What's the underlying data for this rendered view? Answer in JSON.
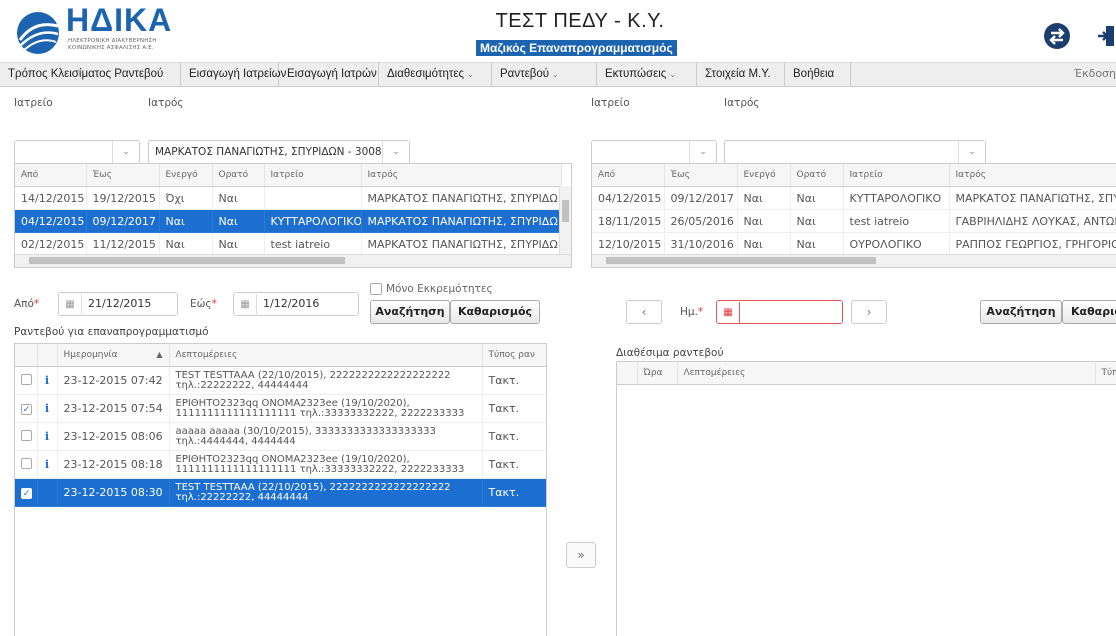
{
  "header": {
    "logo_text": "ΗΔΙΚΑ",
    "logo_sub1": "ΗΛΕΚΤΡΟΝΙΚΗ ΔΙΑΚΥΒΕΡΝΗΣΗ",
    "logo_sub2": "ΚΟΙΝΩΝΙΚΗΣ ΑΣΦΑΛΙΣΗΣ Α.Ε.",
    "title": "ΤΕΣΤ ΠΕΔΥ - Κ.Υ.",
    "subtitle": "Μαζικός Επαναπρογραμματισμός",
    "accent": "#1c64b0"
  },
  "menu": {
    "items": [
      {
        "label": "Τρόπος Κλεισίματος Ραντεβού",
        "caret": ""
      },
      {
        "label": "Εισαγωγή Ιατρείων",
        "caret": ""
      },
      {
        "label": "Εισαγωγή Ιατρών",
        "caret": ""
      },
      {
        "label": "Διαθεσιμότητες",
        "caret": "⌄"
      },
      {
        "label": "Ραντεβού",
        "caret": "⌄"
      },
      {
        "label": "Εκτυπώσεις",
        "caret": "⌄"
      },
      {
        "label": "Στοιχεία Μ.Υ.",
        "caret": ""
      },
      {
        "label": "Βοήθεια",
        "caret": ""
      }
    ],
    "version_label": "Έκδοση"
  },
  "left": {
    "office_label": "Ιατρείο",
    "office_value": "",
    "doctor_label": "Ιατρός",
    "doctor_value": "ΜΑΡΚΑΤΟΣ ΠΑΝΑΓΙΩΤΗΣ, ΣΠΥΡΙΔΩΝ - 3008",
    "grid_headers": [
      "Από",
      "Έως",
      "Ενεργό",
      "Ορατό",
      "Ιατρείο",
      "Ιατρός"
    ],
    "grid_rows": [
      {
        "from": "14/12/2015",
        "to": "19/12/2015",
        "active": "Όχι",
        "visible": "Ναι",
        "office": "",
        "doctor": "ΜΑΡΚΑΤΟΣ ΠΑΝΑΓΙΩΤΗΣ, ΣΠΥΡΙΔΩ",
        "selected": false
      },
      {
        "from": "04/12/2015",
        "to": "09/12/2017",
        "active": "Ναι",
        "visible": "Ναι",
        "office": "ΚΥΤΤΑΡΟΛΟΓΙΚΟ",
        "doctor": "ΜΑΡΚΑΤΟΣ ΠΑΝΑΓΙΩΤΗΣ, ΣΠΥΡΙΔΩ",
        "selected": true
      },
      {
        "from": "02/12/2015",
        "to": "11/12/2015",
        "active": "Ναι",
        "visible": "Ναι",
        "office": "test iatreio",
        "doctor": "ΜΑΡΚΑΤΟΣ ΠΑΝΑΓΙΩΤΗΣ, ΣΠΥΡΙΔΩ",
        "selected": false
      }
    ],
    "from_label": "Από",
    "from_value": "21/12/2015",
    "to_label": "Εώς",
    "to_value": "1/12/2016",
    "pending_only_label": "Μόνο Εκκρεμότητες",
    "search_button": "Αναζήτηση",
    "clear_button": "Καθαρισμός",
    "appointments_title": "Ραντεβού για επαναπρογραμματισμό",
    "appt_headers": {
      "date": "Ημερομηνία",
      "details": "Λεπτομέρειες",
      "type": "Τύπος ραν"
    },
    "appointments": [
      {
        "checked": false,
        "datetime": "23-12-2015 07:42",
        "details": "TEST TESTTAAA (22/10/2015), 2222222222222222222 τηλ.:22222222, 44444444",
        "type": "Τακτ.",
        "selected": false,
        "info": "i"
      },
      {
        "checked": true,
        "datetime": "23-12-2015 07:54",
        "details": "ΕΡΙΘΗΤΟ2323qq ΟΝΟΜΑ2323ee (19/10/2020), 1111111111111111111 τηλ.:33333332222, 2222233333",
        "type": "Τακτ.",
        "selected": false,
        "info": "i"
      },
      {
        "checked": false,
        "datetime": "23-12-2015 08:06",
        "details": "aaaaa aaaaa (30/10/2015), 3333333333333333333 τηλ.:4444444, 4444444",
        "type": "Τακτ.",
        "selected": false,
        "info": "i"
      },
      {
        "checked": false,
        "datetime": "23-12-2015 08:18",
        "details": "ΕΡΙΘΗΤΟ2323qq ΟΝΟΜΑ2323ee (19/10/2020), 1111111111111111111 τηλ.:33333332222, 2222233333",
        "type": "Τακτ.",
        "selected": false,
        "info": "i"
      },
      {
        "checked": true,
        "datetime": "23-12-2015 08:30",
        "details": "TEST TESTTAAA (22/10/2015), 2222222222222222222 τηλ.:22222222, 44444444",
        "type": "Τακτ.",
        "selected": true,
        "info": ""
      }
    ]
  },
  "right": {
    "office_label": "Ιατρείο",
    "office_value": "",
    "doctor_label": "Ιατρός",
    "doctor_value": "",
    "grid_headers": [
      "Από",
      "Έως",
      "Ενεργό",
      "Ορατό",
      "Ιατρείο",
      "Ιατρός"
    ],
    "grid_rows": [
      {
        "from": "04/12/2015",
        "to": "09/12/2017",
        "active": "Ναι",
        "visible": "Ναι",
        "office": "ΚΥΤΤΑΡΟΛΟΓΙΚΟ",
        "doctor": "ΜΑΡΚΑΤΟΣ ΠΑΝΑΓΙΩΤΗΣ, ΣΠΥΡ"
      },
      {
        "from": "18/11/2015",
        "to": "26/05/2016",
        "active": "Ναι",
        "visible": "Ναι",
        "office": "test iatreio",
        "doctor": "ΓΑΒΡΙΗΛΙΔΗΣ ΛΟΥΚΑΣ, ΑΝΤΩΝΙ"
      },
      {
        "from": "12/10/2015",
        "to": "31/10/2016",
        "active": "Ναι",
        "visible": "Ναι",
        "office": "ΟΥΡΟΛΟΓΙΚΟ",
        "doctor": "ΡΑΠΠΟΣ ΓΕΩΡΓΙΟΣ, ΓΡΗΓΟΡΙΟΣ"
      }
    ],
    "prev_button": "‹",
    "next_button": "›",
    "date_label": "Ημ.",
    "date_value": "",
    "search_button": "Αναζήτηση",
    "clear_button": "Καθαρισ",
    "available_title": "Διαθέσιμα ραντεβού",
    "available_headers": {
      "hour": "Ώρα",
      "details": "Λεπτομέρειες",
      "type": "Τύπο"
    }
  },
  "move_button": "»"
}
